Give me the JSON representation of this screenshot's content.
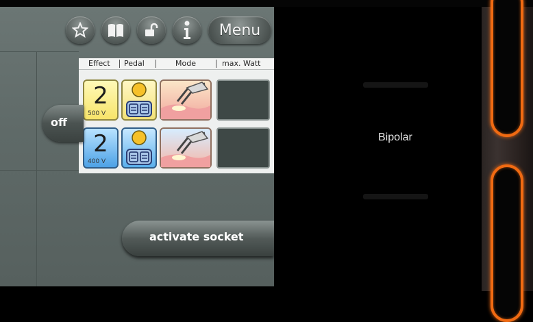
{
  "toolbar": {
    "icons": [
      "star-icon",
      "book-icon",
      "unlock-icon",
      "info-icon"
    ],
    "menu_label": "Menu"
  },
  "table": {
    "headers": [
      "Effect",
      "Pedal",
      "Mode",
      "max. Watt"
    ],
    "rows": [
      {
        "effect": "2",
        "voltage": "500 V",
        "color": "yellow",
        "mode": "bipolar-coag-icon"
      },
      {
        "effect": "2",
        "voltage": "400 V",
        "color": "blue",
        "mode": "bipolar-coag-icon"
      }
    ]
  },
  "buttons": {
    "off_label": "off",
    "activate_label": "activate socket"
  },
  "socket": {
    "name": "Bipolar"
  },
  "colors": {
    "accent_orange": "#f06a12",
    "effect_yellow": "#f7e46a",
    "effect_blue": "#4da2e6",
    "panel_gray": "#5f6a68"
  }
}
